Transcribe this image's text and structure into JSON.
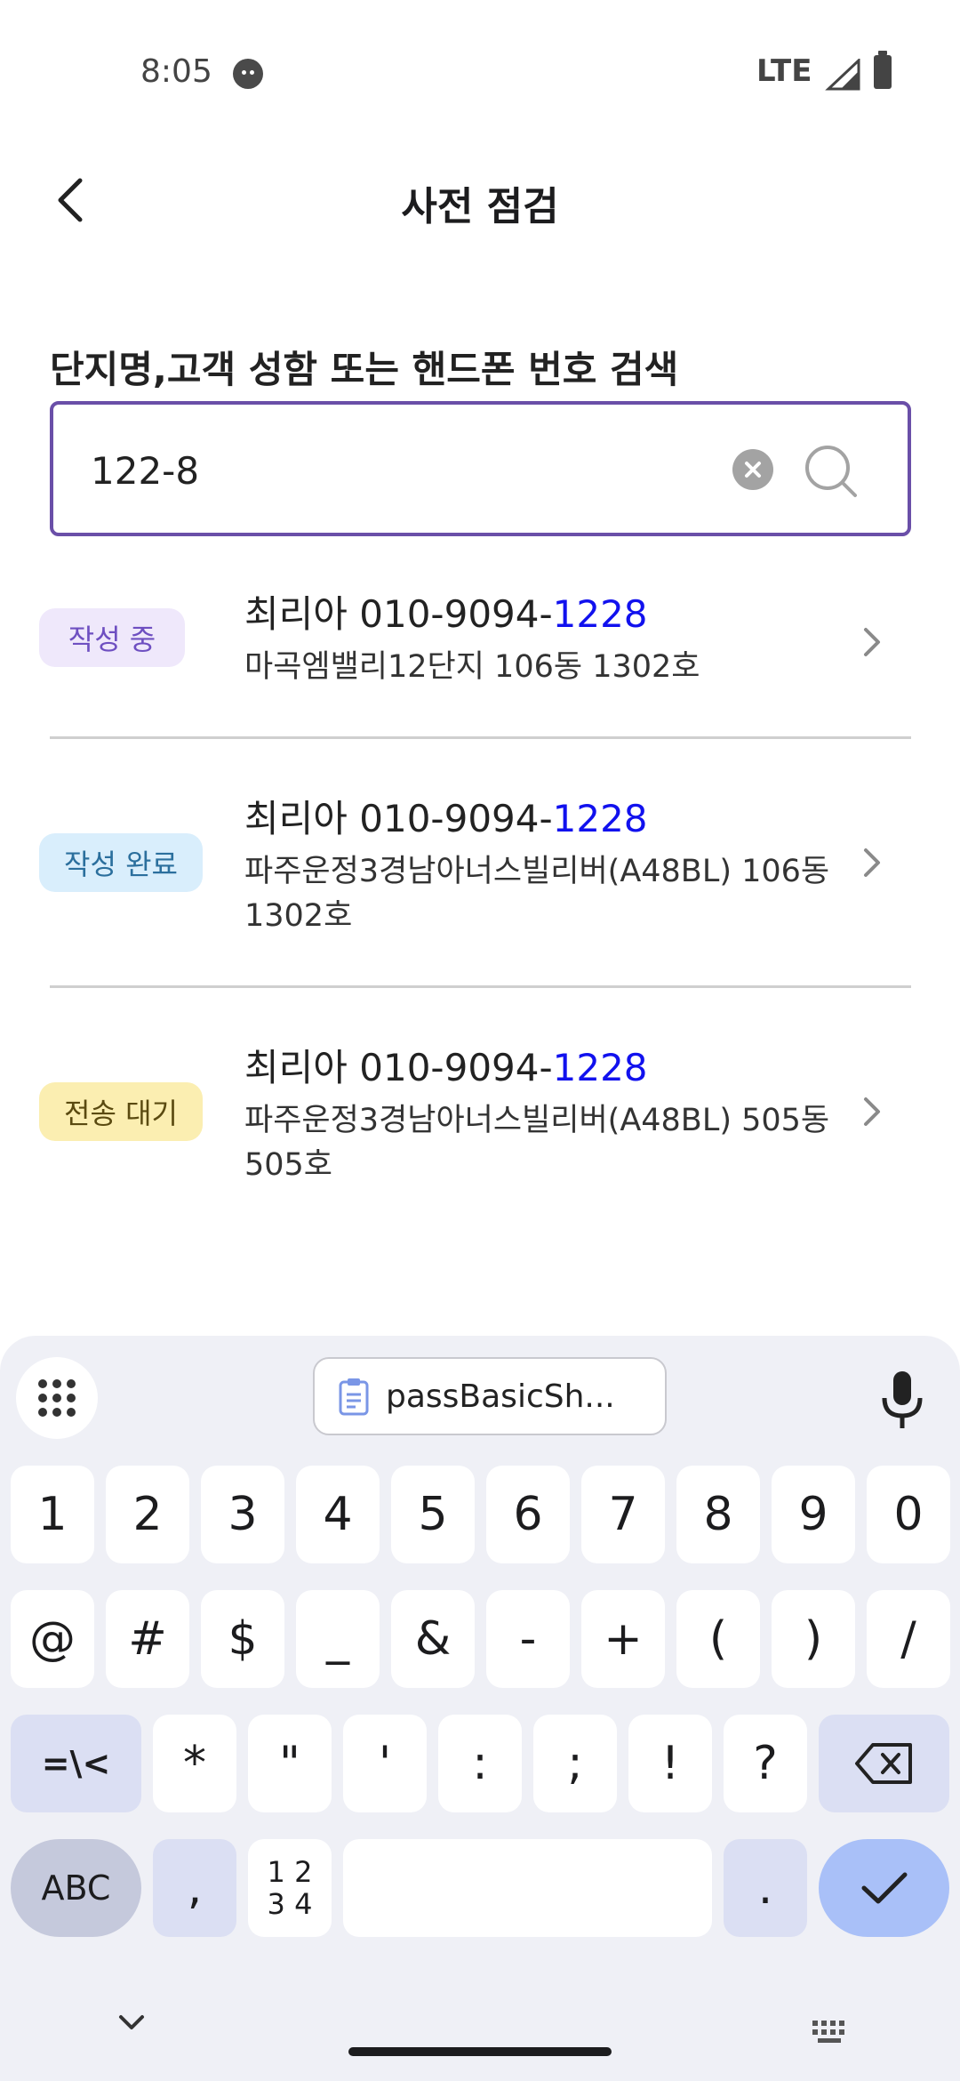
{
  "status_bar": {
    "time": "8:05",
    "network": "LTE"
  },
  "app_bar": {
    "title": "사전 점검"
  },
  "search": {
    "label": "단지명,고객 성함 또는 핸드폰 번호 검색",
    "value": "122-8"
  },
  "results": [
    {
      "badge": "작성 중",
      "name_phone_prefix": "최리아 010-9094-",
      "phone_highlight": "1228",
      "address": "마곡엠밸리12단지 106동 1302호"
    },
    {
      "badge": "작성 완료",
      "name_phone_prefix": "최리아 010-9094-",
      "phone_highlight": "1228",
      "address": "파주운정3경남아너스빌리버(A48BL) 106동 1302호"
    },
    {
      "badge": "전송 대기",
      "name_phone_prefix": "최리아 010-9094-",
      "phone_highlight": "1228",
      "address": "파주운정3경남아너스빌리버(A48BL) 505동 505호"
    }
  ],
  "keyboard": {
    "clipboard_suggestion": "passBasicSh...",
    "row1": [
      "1",
      "2",
      "3",
      "4",
      "5",
      "6",
      "7",
      "8",
      "9",
      "0"
    ],
    "row2": [
      "@",
      "#",
      "$",
      "_",
      "&",
      "-",
      "+",
      "(",
      ")",
      "/"
    ],
    "row3": [
      "=\\<",
      "*",
      "\"",
      "'",
      ":",
      ";",
      "!",
      "?"
    ],
    "abc": "ABC",
    "comma": ",",
    "nums_top": "1 2",
    "nums_bottom": "3 4",
    "period": "."
  },
  "colors": {
    "accent_border": "#6a4fa8",
    "highlight_text": "#1111ee",
    "enter_key": "#a9c0f8"
  }
}
